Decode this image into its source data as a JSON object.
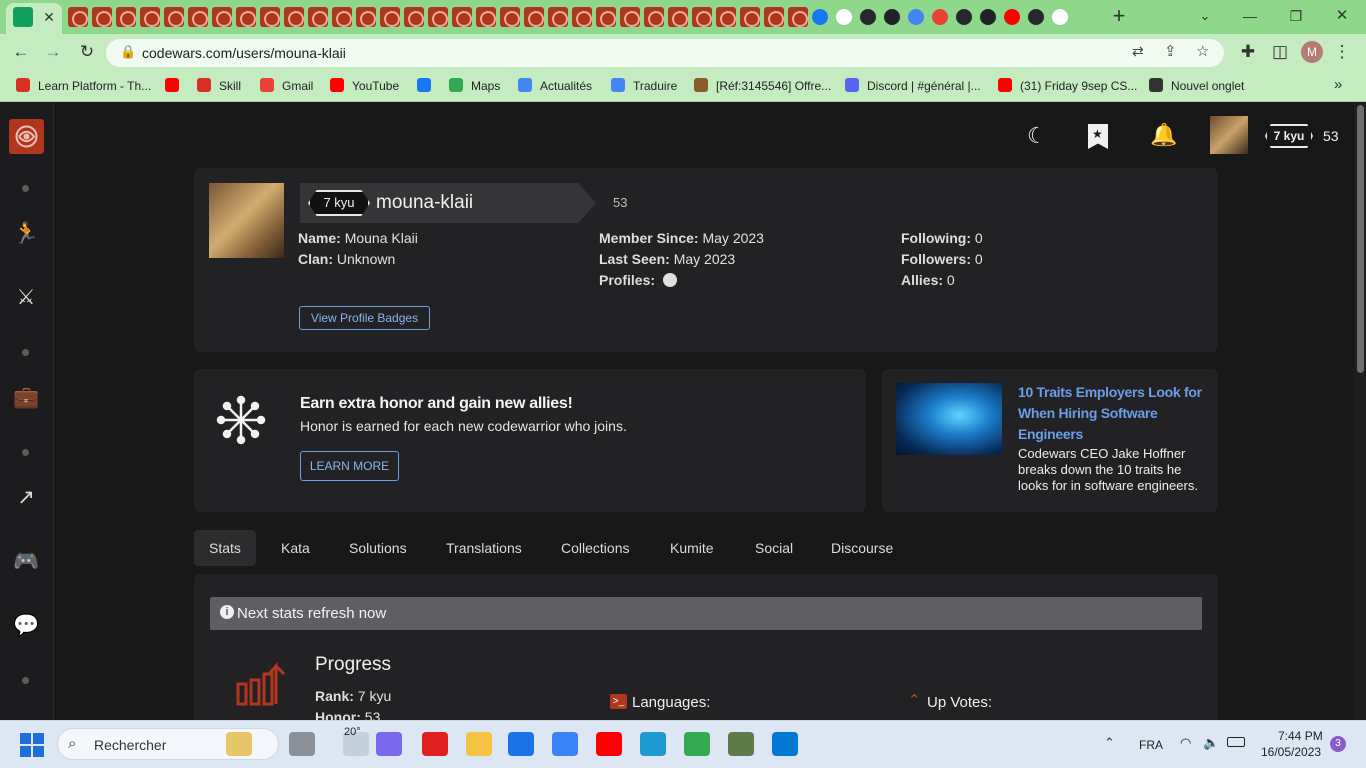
{
  "browser": {
    "url": "codewars.com/users/mouna-klaii",
    "tab_close_glyph": "✕",
    "new_tab_glyph": "+",
    "profile_initial": "M",
    "bookmarks": [
      {
        "label": "Learn Platform - Th...",
        "icon": "learn-icon",
        "color": "#d93025"
      },
      {
        "label": "",
        "icon": "youtube-icon",
        "color": "#ff0000"
      },
      {
        "label": "Skill",
        "icon": "skill-icon",
        "color": "#d93025"
      },
      {
        "label": "Gmail",
        "icon": "gmail-icon",
        "color": "#ea4335"
      },
      {
        "label": "YouTube",
        "icon": "youtube-icon",
        "color": "#ff0000"
      },
      {
        "label": "",
        "icon": "facebook-icon",
        "color": "#1877f2"
      },
      {
        "label": "Maps",
        "icon": "maps-icon",
        "color": "#34a853"
      },
      {
        "label": "Actualités",
        "icon": "news-icon",
        "color": "#4285f4"
      },
      {
        "label": "Traduire",
        "icon": "translate-icon",
        "color": "#4285f4"
      },
      {
        "label": "[Réf:3145546] Offre...",
        "icon": "offer-icon",
        "color": "#8b5a2b"
      },
      {
        "label": "Discord | #général |...",
        "icon": "discord-icon",
        "color": "#5865f2"
      },
      {
        "label": "(31) Friday 9sep CS...",
        "icon": "youtube-icon",
        "color": "#ff0000"
      },
      {
        "label": "Nouvel onglet",
        "icon": "globe-icon",
        "color": "#333333"
      }
    ]
  },
  "header": {
    "rank": "7 kyu",
    "honor": "53"
  },
  "profile": {
    "rank": "7 kyu",
    "username": "mouna-klaii",
    "honor": "53",
    "name_label": "Name:",
    "name": "Mouna Klaii",
    "clan_label": "Clan:",
    "clan": "Unknown",
    "member_since_label": "Member Since:",
    "member_since": "May 2023",
    "last_seen_label": "Last Seen:",
    "last_seen": "May 2023",
    "profiles_label": "Profiles:",
    "following_label": "Following:",
    "following": "0",
    "followers_label": "Followers:",
    "followers": "0",
    "allies_label": "Allies:",
    "allies": "0",
    "badges_button": "View Profile Badges"
  },
  "promo": {
    "title": "Earn extra honor and gain new allies!",
    "text": "Honor is earned for each new codewarrior who joins.",
    "button": "LEARN MORE"
  },
  "article": {
    "title": "10 Traits Employers Look for When Hiring Software Engineers",
    "text": "Codewars CEO Jake Hoffner breaks down the 10 traits he looks for in software engineers."
  },
  "tabs": [
    "Stats",
    "Kata",
    "Solutions",
    "Translations",
    "Collections",
    "Kumite",
    "Social",
    "Discourse"
  ],
  "stats": {
    "notice": "Next stats refresh now",
    "progress_title": "Progress",
    "rank_label": "Rank:",
    "rank": "7 kyu",
    "honor_label": "Honor:",
    "honor": "53",
    "languages_label": "Languages:",
    "upvotes_label": "Up Votes:"
  },
  "taskbar": {
    "search_placeholder": "Rechercher",
    "weather": "20°",
    "language": "FRA",
    "time": "7:44 PM",
    "date": "16/05/2023",
    "notifications": "3"
  },
  "colors": {
    "accent_red": "#b1361e",
    "link_blue": "#6a9fe8",
    "brand_green": "#8fd78a"
  }
}
